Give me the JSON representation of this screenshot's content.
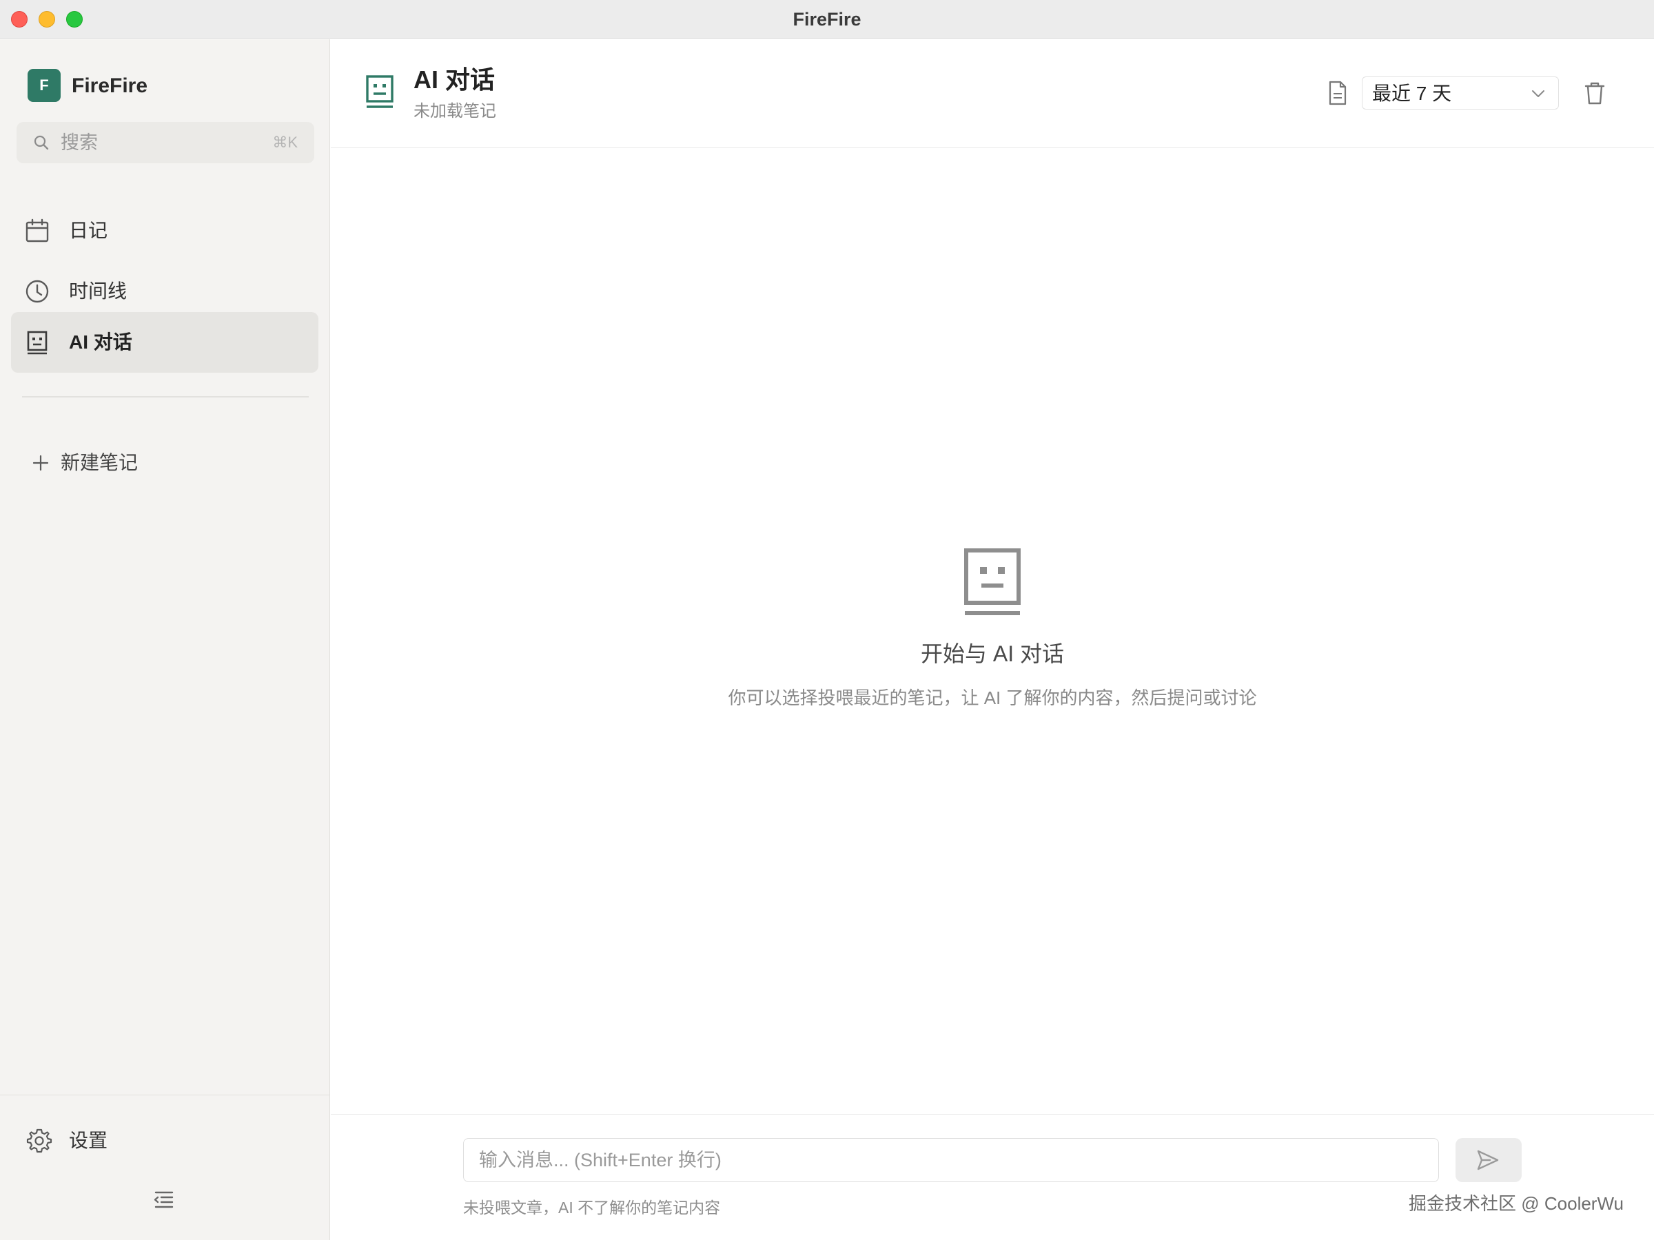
{
  "window": {
    "title": "FireFire"
  },
  "sidebar": {
    "brand": {
      "logo_letter": "F",
      "name": "FireFire",
      "logo_color": "#2f7a66"
    },
    "search": {
      "placeholder": "搜索",
      "shortcut": "⌘K"
    },
    "nav": [
      {
        "label": "日记",
        "icon": "calendar-icon",
        "active": false
      },
      {
        "label": "时间线",
        "icon": "clock-icon",
        "active": false
      },
      {
        "label": "AI 对话",
        "icon": "robot-chat-icon",
        "active": true
      }
    ],
    "new_note_label": "新建笔记",
    "settings_label": "设置"
  },
  "header": {
    "title": "AI 对话",
    "subtitle": "未加载笔记",
    "range_select": {
      "value": "最近 7 天"
    }
  },
  "empty_state": {
    "title": "开始与 AI 对话",
    "description": "你可以选择投喂最近的笔记，让 AI 了解你的内容，然后提问或讨论"
  },
  "composer": {
    "placeholder": "输入消息... (Shift+Enter 换行)",
    "hint": "未投喂文章，AI 不了解你的笔记内容",
    "watermark": "掘金技术社区 @ CoolerWu"
  },
  "colors": {
    "accent": "#2f7a66",
    "sidebar_bg": "#f4f3f1",
    "active_item_bg": "#e6e5e2"
  }
}
